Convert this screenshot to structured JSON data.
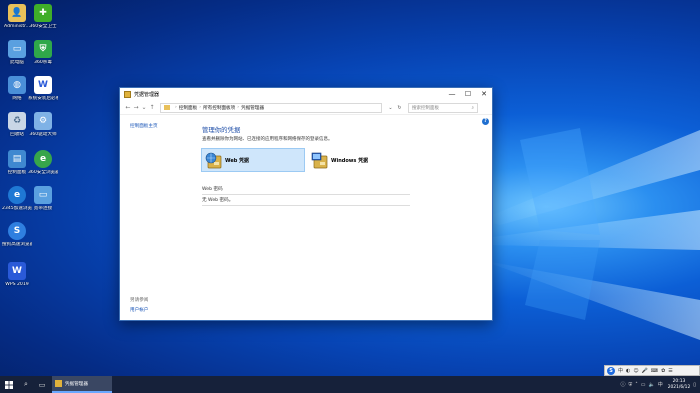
{
  "desktop": {
    "icons": [
      {
        "label": "Administr...",
        "icon": "user-folder-icon",
        "color": "#e8c05a"
      },
      {
        "label": "360安全卫士",
        "icon": "360-security-icon",
        "color": "#3fae29"
      },
      {
        "label": "此电脑",
        "icon": "computer-icon",
        "color": "#5aa0e0"
      },
      {
        "label": "360杀毒",
        "icon": "360-antivirus-icon",
        "color": "#2fa84a"
      },
      {
        "label": "网络",
        "icon": "network-icon",
        "color": "#4a8fd8"
      },
      {
        "label": "系统安装后必看.docx",
        "icon": "word-doc-icon",
        "color": "#ffffff"
      },
      {
        "label": "回收站",
        "icon": "recycle-bin-icon",
        "color": "#c9d6e6"
      },
      {
        "label": "360驱动大师",
        "icon": "360-driver-icon",
        "color": "#7fb2e6"
      },
      {
        "label": "控制面板",
        "icon": "control-panel-icon",
        "color": "#3f88d0"
      },
      {
        "label": "360安全浏览器",
        "icon": "360-browser-icon",
        "color": "#37a54a"
      },
      {
        "label": "2345加速浏览器",
        "icon": "2345-browser-icon",
        "color": "#1f78d4"
      },
      {
        "label": "宽带连接",
        "icon": "broadband-icon",
        "color": "#5aa0e0"
      },
      {
        "label": "搜狗高速浏览器",
        "icon": "sogou-browser-icon",
        "color": "#2f7fe0"
      },
      {
        "label": "WPS 2019",
        "icon": "wps-icon",
        "color": "#2a5ad8"
      }
    ]
  },
  "window": {
    "title": "凭据管理器",
    "min_label": "—",
    "max_label": "☐",
    "close_label": "✕",
    "nav": {
      "back": "←",
      "forward": "→",
      "dropdown": "⌄",
      "up": "↑"
    },
    "breadcrumb": [
      "控制面板",
      "所有控制面板项",
      "凭据管理器"
    ],
    "breadcrumb_sep": "›",
    "search_placeholder": "搜索控制面板",
    "sidebar": {
      "home_link": "控制面板主页",
      "see_also": "另请参阅",
      "user_accounts": "用户帐户"
    },
    "heading": "管理你的凭据",
    "description": "查看并删除你为网站、已连接的应用程序和网络保存的登录信息。",
    "web_credentials": "Web 凭据",
    "windows_credentials": "Windows 凭据",
    "section_header": "Web 密码",
    "section_empty": "无 Web 密码。",
    "help": "?"
  },
  "taskbar": {
    "search_icon": "⌕",
    "task_view_icon": "▭",
    "app_label": "凭据管理器",
    "time": "20:13",
    "date": "2021/6/12",
    "ime_label": "中"
  }
}
